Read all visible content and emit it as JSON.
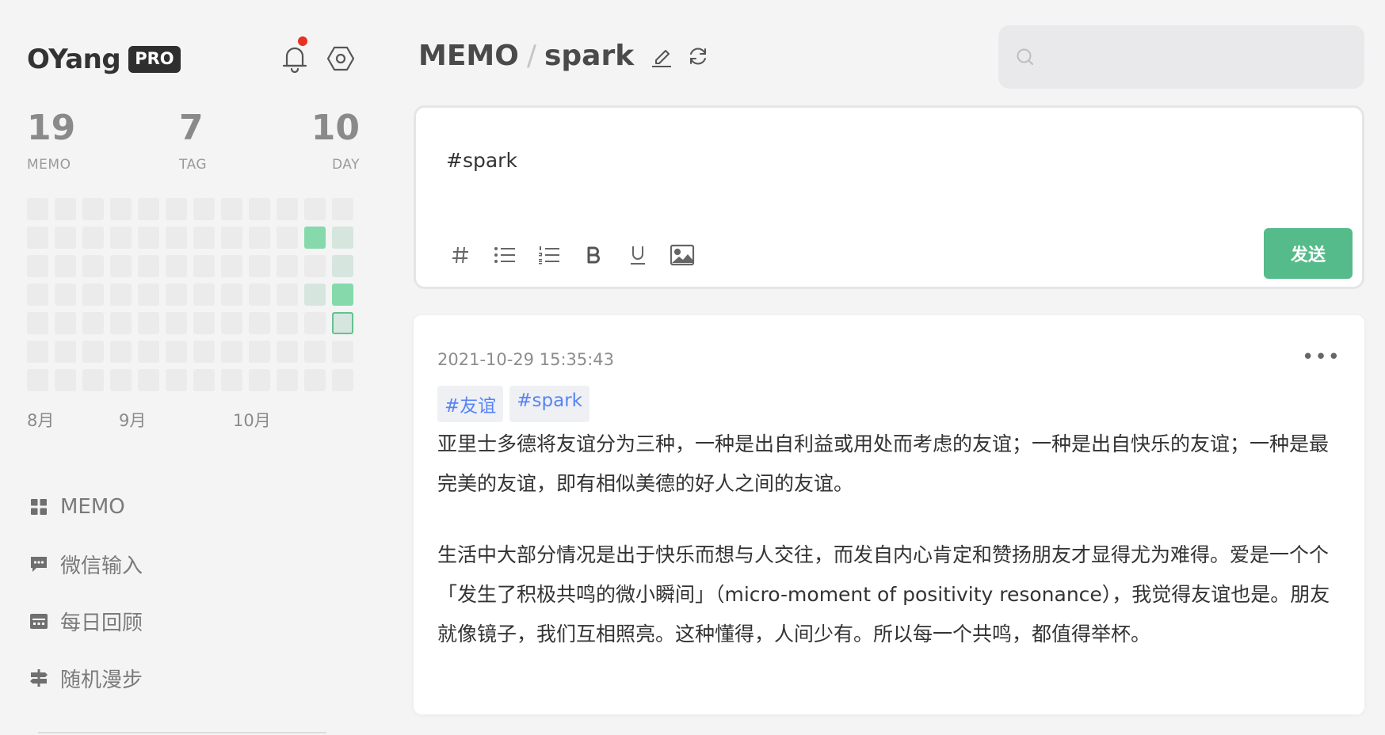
{
  "brand": {
    "name": "OYang",
    "badge": "PRO"
  },
  "icons": {
    "bell": "bell-icon",
    "settings": "settings-icon"
  },
  "stats": [
    {
      "value": "19",
      "label": "MEMO"
    },
    {
      "value": "7",
      "label": "TAG"
    },
    {
      "value": "10",
      "label": "DAY"
    }
  ],
  "heatmap": {
    "colors": {
      "empty": "#ebebeb",
      "light": "#d6e6df",
      "green": "#85d9ab",
      "today_border": "#63c28e"
    },
    "rows": [
      [
        "empty",
        "empty",
        "empty",
        "empty",
        "empty",
        "empty",
        "empty",
        "empty",
        "empty",
        "empty",
        "empty",
        "empty"
      ],
      [
        "empty",
        "empty",
        "empty",
        "empty",
        "empty",
        "empty",
        "empty",
        "empty",
        "empty",
        "empty",
        "green",
        "light"
      ],
      [
        "empty",
        "empty",
        "empty",
        "empty",
        "empty",
        "empty",
        "empty",
        "empty",
        "empty",
        "empty",
        "empty",
        "light"
      ],
      [
        "empty",
        "empty",
        "empty",
        "empty",
        "empty",
        "empty",
        "empty",
        "empty",
        "empty",
        "empty",
        "light",
        "green"
      ],
      [
        "empty",
        "empty",
        "empty",
        "empty",
        "empty",
        "empty",
        "empty",
        "empty",
        "empty",
        "empty",
        "empty",
        "today"
      ],
      [
        "empty",
        "empty",
        "empty",
        "empty",
        "empty",
        "empty",
        "empty",
        "empty",
        "empty",
        "empty",
        "empty",
        "empty"
      ],
      [
        "empty",
        "empty",
        "empty",
        "empty",
        "empty",
        "empty",
        "empty",
        "empty",
        "empty",
        "empty",
        "empty",
        "empty"
      ]
    ],
    "months": [
      "8月",
      "9月",
      "10月"
    ]
  },
  "nav": [
    {
      "label": "MEMO",
      "icon": "grid-icon"
    },
    {
      "label": "微信输入",
      "icon": "chat-icon"
    },
    {
      "label": "每日回顾",
      "icon": "calendar-icon"
    },
    {
      "label": "随机漫步",
      "icon": "signpost-icon"
    }
  ],
  "header": {
    "root": "MEMO",
    "separator": "/",
    "tag": "spark"
  },
  "search": {
    "placeholder": "",
    "value": ""
  },
  "editor": {
    "content": "#spark",
    "send_label": "发送",
    "accent": "#55bb8a",
    "tools": [
      "hash-icon",
      "bullet-list-icon",
      "numbered-list-icon",
      "bold-icon",
      "underline-icon",
      "image-icon"
    ]
  },
  "memo": {
    "time": "2021-10-29 15:35:43",
    "tags": [
      "#友谊",
      "#spark"
    ],
    "paragraphs": [
      "亚里士多德将友谊分为三种，一种是出自利益或用处而考虑的友谊；一种是出自快乐的友谊；一种是最完美的友谊，即有相似美德的好人之间的友谊。",
      "生活中大部分情况是出于快乐而想与人交往，而发自内心肯定和赞扬朋友才显得尤为难得。爱是一个个「发生了积极共鸣的微小瞬间」（micro-moment of positivity resonance），我觉得友谊也是。朋友就像镜子，我们互相照亮。这种懂得，人间少有。所以每一个共鸣，都值得举杯。"
    ]
  }
}
